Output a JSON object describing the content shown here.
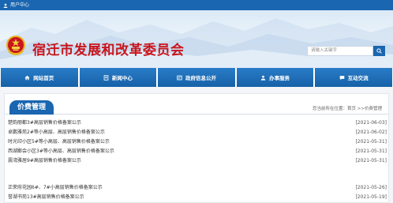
{
  "topbar": {
    "user_center": "用户中心"
  },
  "header": {
    "site_title": "宿迁市发展和改革委员会",
    "search_placeholder": "请输入关键字"
  },
  "nav": {
    "items": [
      {
        "label": "网站首页",
        "icon": "home-icon"
      },
      {
        "label": "新闻中心",
        "icon": "document-icon"
      },
      {
        "label": "政府信息公开",
        "icon": "info-doc-icon"
      },
      {
        "label": "办事服务",
        "icon": "people-icon"
      },
      {
        "label": "互动交流",
        "icon": "chat-icon"
      }
    ]
  },
  "panel": {
    "tab": "价费管理",
    "breadcrumb_prefix": "您当前所在位置：",
    "breadcrumb_path": "首页 >>价费管理"
  },
  "items": [
    {
      "title": "楚韵丽都3#高层销售价格备案公示",
      "date": "[2021-06-03]"
    },
    {
      "title": "卓鹏雅苑2#等小高层、高层销售价格备案公示",
      "date": "[2021-06-02]"
    },
    {
      "title": "时光印小区5#等小高层、高层销售价格备案公示",
      "date": "[2021-05-31]"
    },
    {
      "title": "西湖鄙会小区3#等小高层、高层销售价格备案公示",
      "date": "[2021-05-31]"
    },
    {
      "title": "震湾雅居9#高层销售价格备案公示",
      "date": "[2021-05-31]"
    },
    {
      "title": "正荣府花园6#、7#小高层销售价格备案公示",
      "date": "[2021-05-26]"
    },
    {
      "title": "誉湖书苑13#高层销售价格备案公示",
      "date": "[2021-05-19]"
    }
  ],
  "colors": {
    "primary": "#1a66b0",
    "title_red": "#c8161d"
  }
}
